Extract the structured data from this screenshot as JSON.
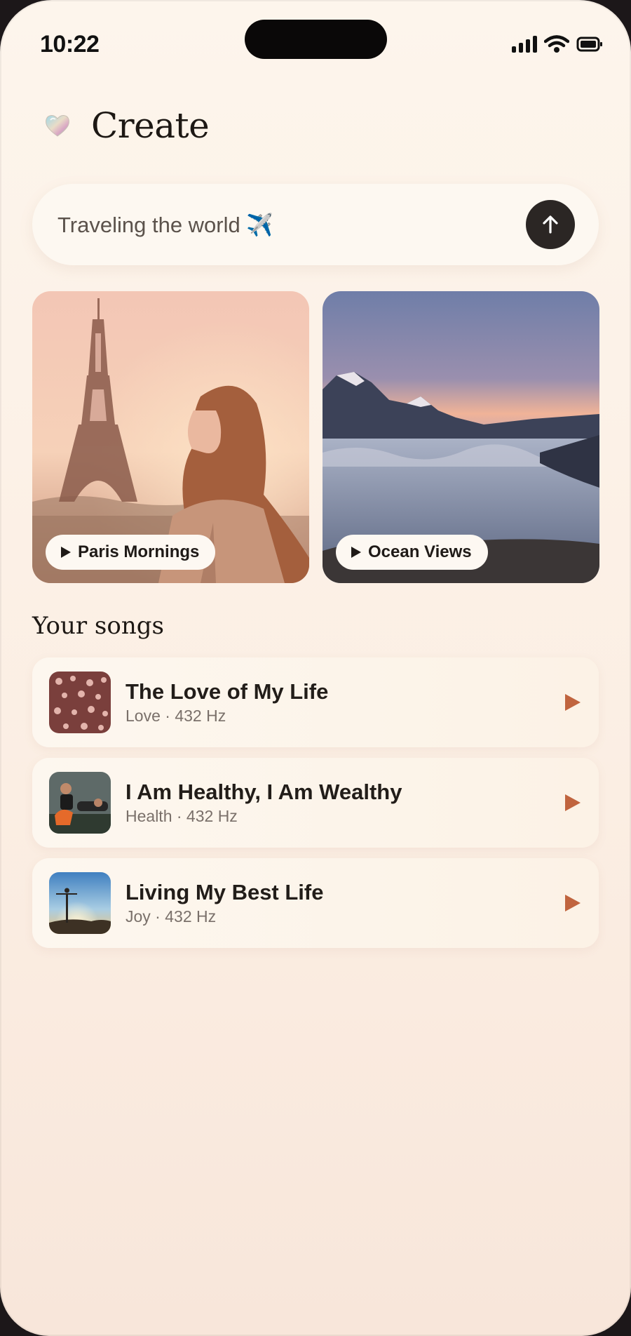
{
  "status_bar": {
    "time": "10:22"
  },
  "header": {
    "title": "Create",
    "icon": "heart-icon"
  },
  "prompt": {
    "value": "Traveling the world ✈️"
  },
  "featured": [
    {
      "label": "Paris Mornings"
    },
    {
      "label": "Ocean Views"
    }
  ],
  "songs_section": {
    "title": "Your songs"
  },
  "songs": [
    {
      "title": "The Love of My Life",
      "meta": "Love · 432 Hz"
    },
    {
      "title": "I Am Healthy, I Am Wealthy",
      "meta": "Health · 432 Hz"
    },
    {
      "title": "Living My Best Life",
      "meta": "Joy · 432 Hz"
    }
  ],
  "colors": {
    "accent_play": "#c0643e",
    "background": "#fdf5ec",
    "button_dark": "#2b2624"
  }
}
